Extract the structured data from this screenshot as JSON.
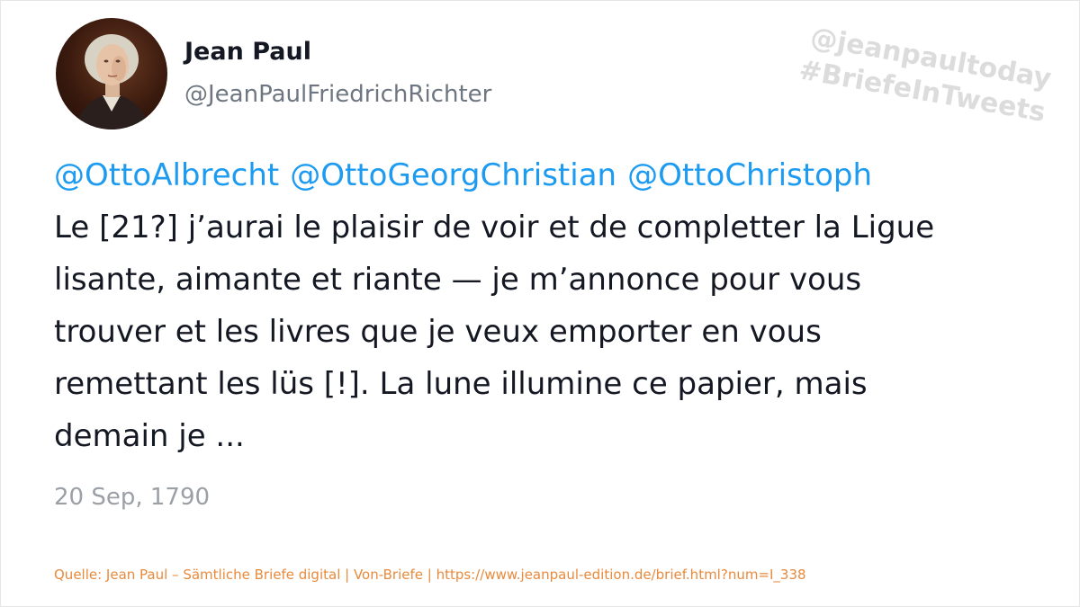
{
  "author": {
    "name": "Jean Paul",
    "handle": "@JeanPaulFriedrichRichter",
    "avatar_icon": "portrait-avatar"
  },
  "watermark": {
    "line1": "@jeanpaultoday",
    "line2": "#BriefeInTweets"
  },
  "tweet": {
    "mentions": [
      "@OttoAlbrecht",
      "@OttoGeorgChristian",
      "@OttoChristoph"
    ],
    "lines": [
      "Le [21?] j’aurai le plaisir de voir et de completter la Ligue",
      "lisante, aimante et riante — je m’annonce pour vous",
      "trouver et les livres que je veux emporter en vous",
      "remettant les lüs [!]. La lune illumine ce papier, mais",
      "demain je ..."
    ],
    "date": "20 Sep, 1790"
  },
  "source": "Quelle: Jean Paul – Sämtliche Briefe digital | Von-Briefe | https://www.jeanpaul-edition.de/brief.html?num=I_338",
  "colors": {
    "mention": "#1d9bf0",
    "text": "#141823",
    "muted": "#9aa0a6",
    "source": "#e88a3c",
    "watermark": "#dcdcdc"
  }
}
